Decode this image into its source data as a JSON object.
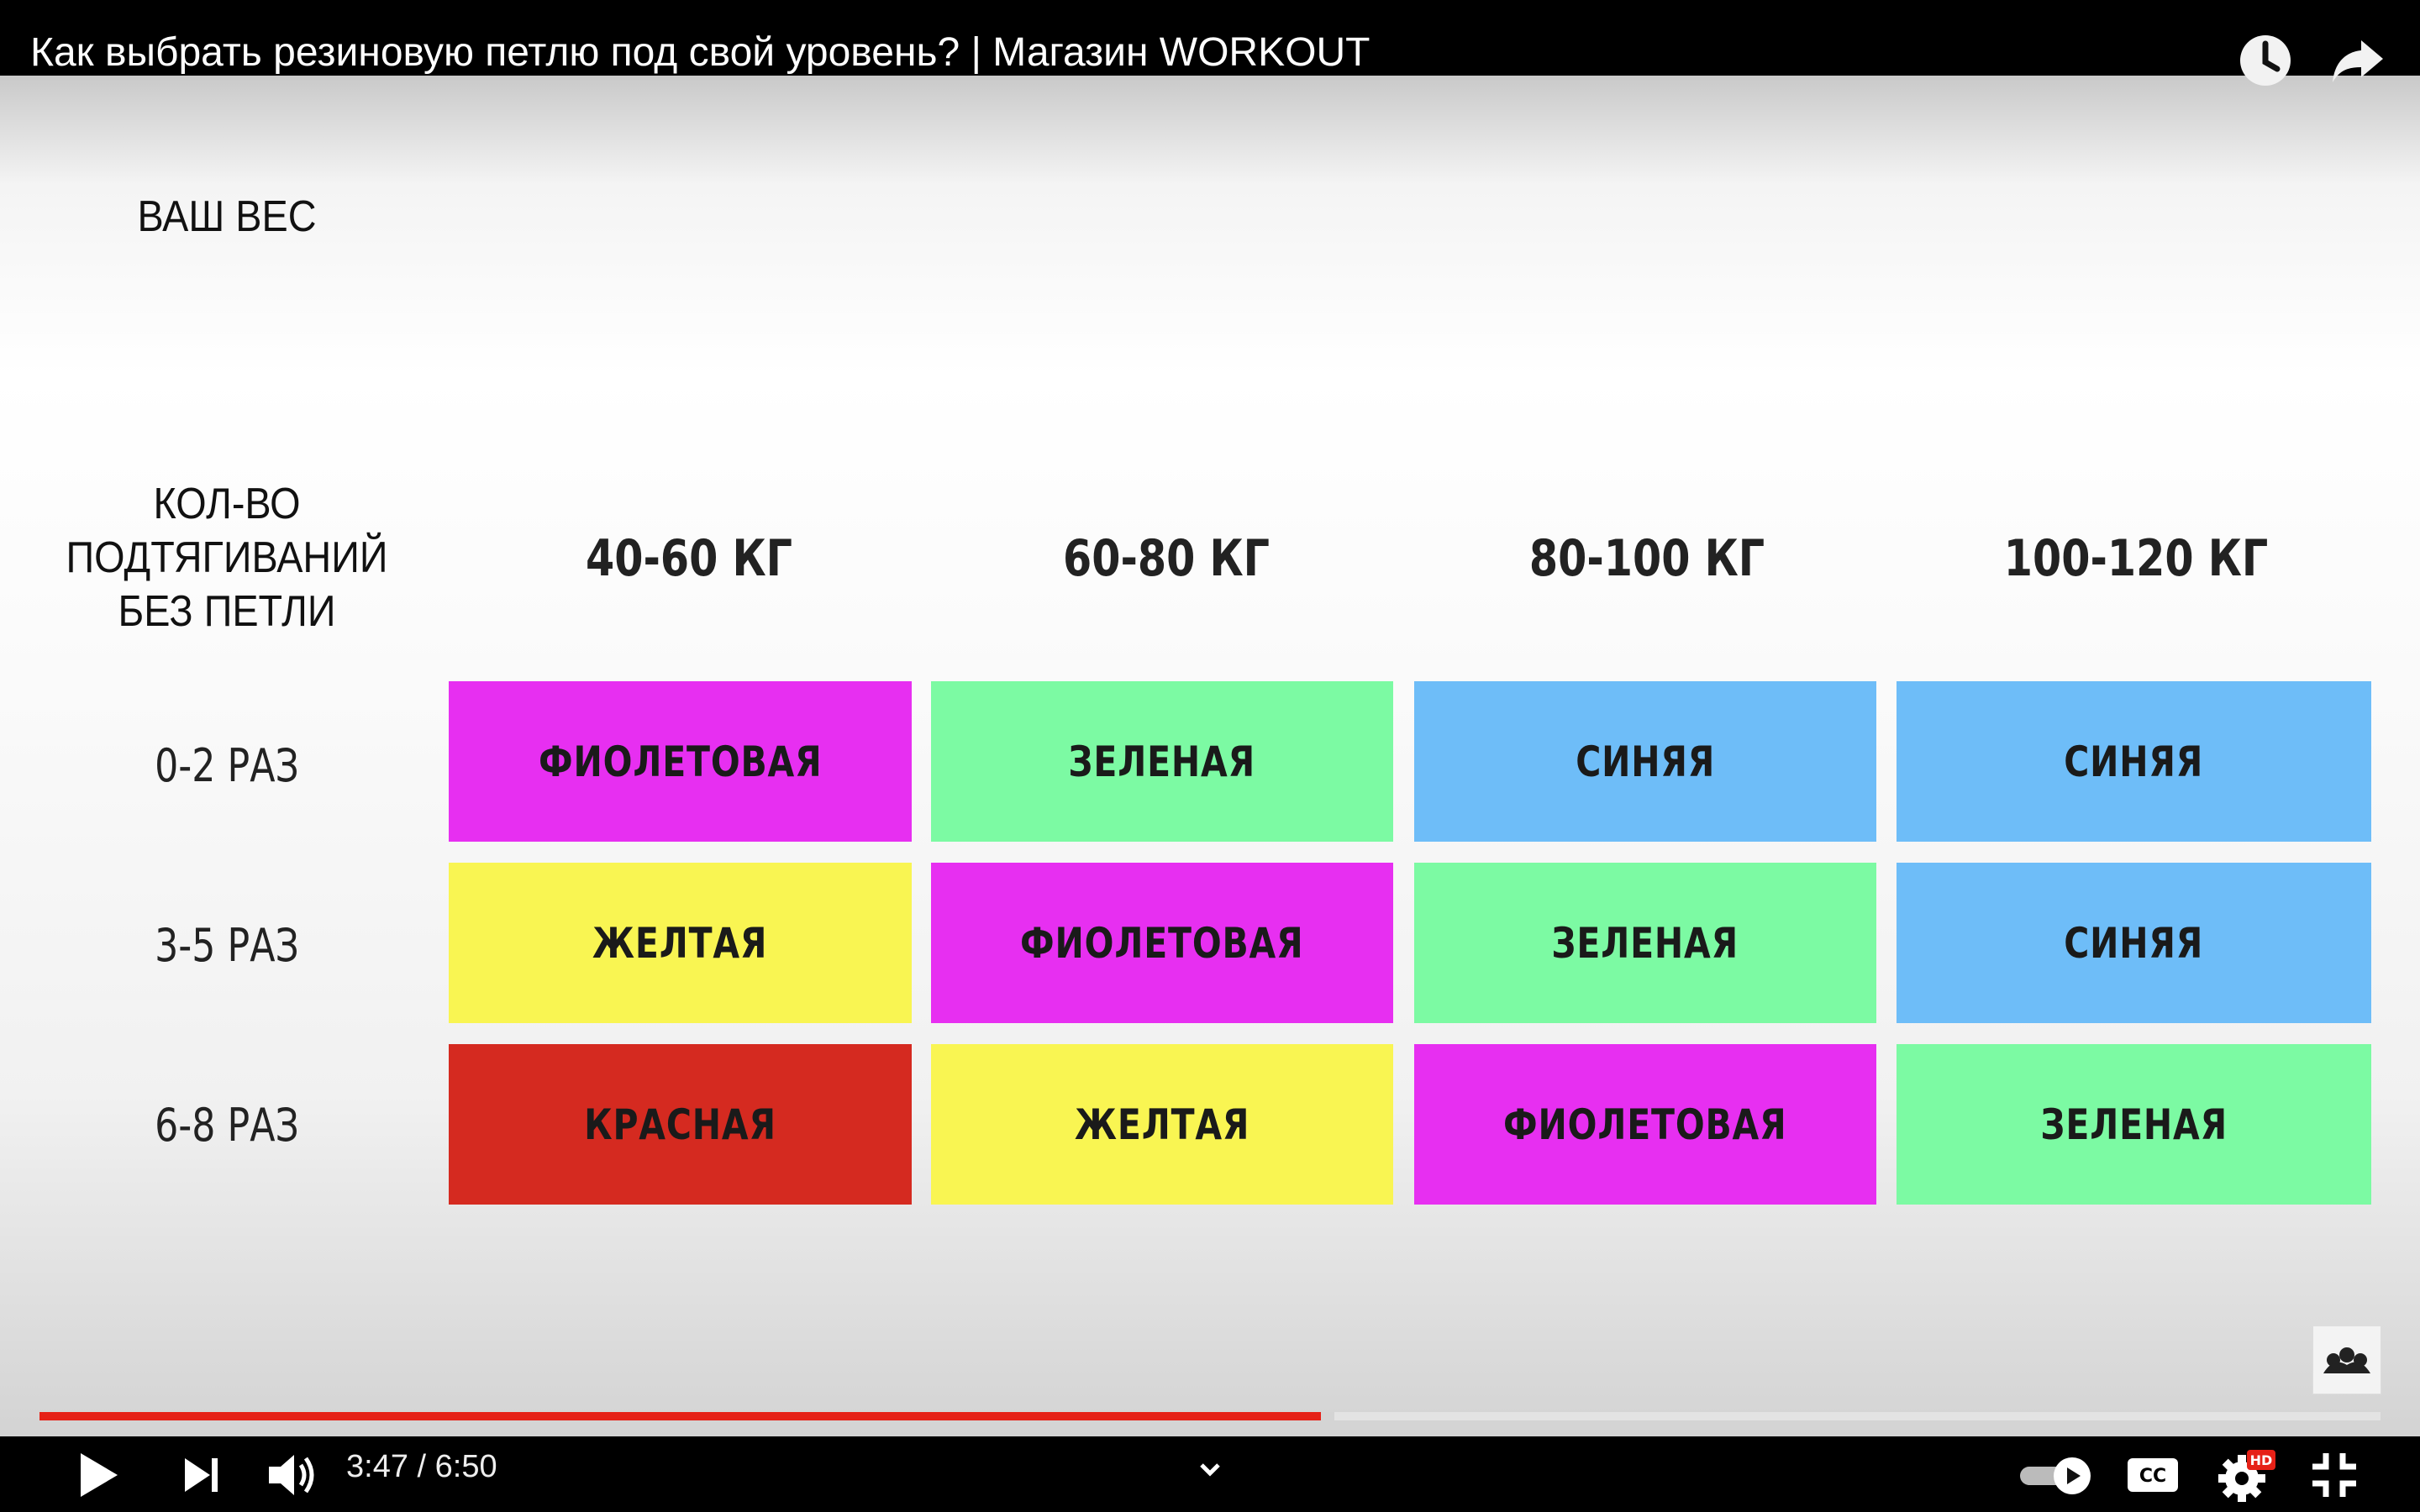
{
  "player": {
    "title": "Как выбрать резиновую петлю под свой уровень? | Магазин WORKOUT",
    "current_time": "3:47",
    "separator": "/",
    "duration": "6:50",
    "progress_played_fraction": 0.5475,
    "progress_buffered_fraction": 0.5532,
    "icons": {
      "watch_later": "clock-icon",
      "share": "share-arrow-icon",
      "play": "play-icon",
      "next": "next-icon",
      "volume": "volume-icon",
      "chapters": "chevron-down-icon",
      "autoplay": "autoplay-toggle-icon",
      "captions": "cc-icon",
      "settings": "gear-icon",
      "exit_fullscreen": "exit-fullscreen-icon",
      "channel": "channel-logo-icon"
    },
    "settings_badge": "HD",
    "captions_label": "CC",
    "colors": {
      "progress": "#e62117",
      "badge": "#e62117"
    }
  },
  "table": {
    "header_weight": "ВАШ ВЕС",
    "header_pullups_line1": "КОЛ-ВО",
    "header_pullups_line2": "ПОДТЯГИВАНИЙ",
    "header_pullups_line3": "БЕЗ ПЕТЛИ",
    "weights": [
      "40-60 КГ",
      "60-80 КГ",
      "80-100 КГ",
      "100-120 КГ"
    ],
    "rows": [
      {
        "label": "0-2 РАЗ",
        "cells": [
          "ФИОЛЕТОВАЯ",
          "ЗЕЛЕНАЯ",
          "СИНЯЯ",
          "СИНЯЯ"
        ]
      },
      {
        "label": "3-5 РАЗ",
        "cells": [
          "ЖЕЛТАЯ",
          "ФИОЛЕТОВАЯ",
          "ЗЕЛЕНАЯ",
          "СИНЯЯ"
        ]
      },
      {
        "label": "6-8 РАЗ",
        "cells": [
          "КРАСНАЯ",
          "ЖЕЛТАЯ",
          "ФИОЛЕТОВАЯ",
          "ЗЕЛЕНАЯ"
        ]
      }
    ],
    "colors": {
      "purple": "#e72ff1",
      "green": "#7cfaa3",
      "blue": "#6ebdf8",
      "yellow": "#f9f552",
      "red": "#d52a20"
    }
  }
}
